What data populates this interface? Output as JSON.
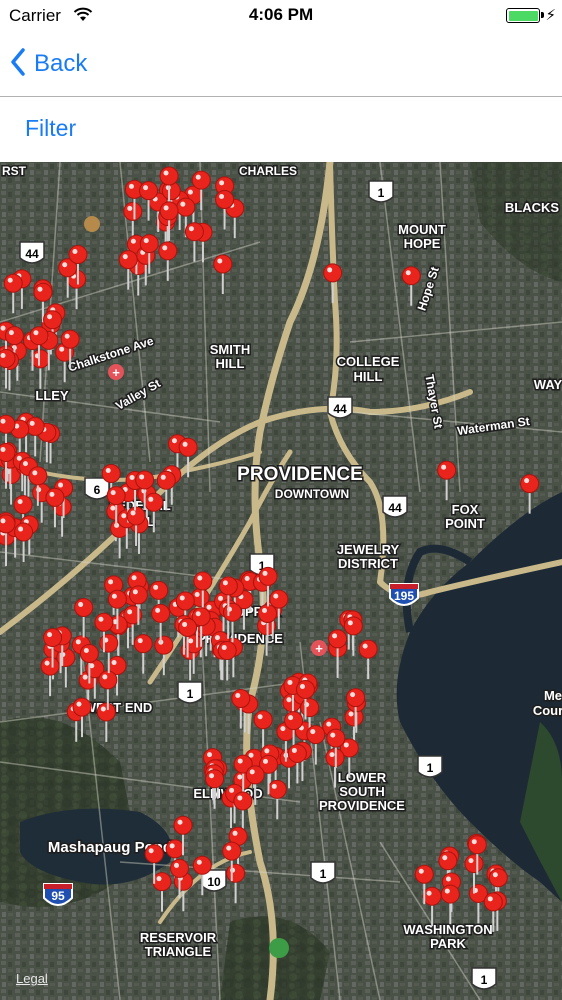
{
  "status": {
    "carrier": "Carrier",
    "time": "4:06 PM",
    "battery_level": 1.0
  },
  "nav": {
    "back_label": "Back",
    "back_icon": "chevron-left-icon"
  },
  "filter": {
    "label": "Filter"
  },
  "map": {
    "style": "satellite-hybrid",
    "pin_color": "#e8241c",
    "place_labels": [
      "CHARLES",
      "RST",
      "BLACKS",
      "MOUNT",
      "HOPE",
      "Hope St",
      "Chalkstone Ave",
      "SMITH",
      "HILL",
      "COLLEGE",
      "HILL",
      "Thayer St",
      "WAY",
      "Valley St",
      "LLEY",
      "Waterman St",
      "PROVIDENCE",
      "DOWNTOWN",
      "FOX",
      "POINT",
      "FEDERAL",
      "HILL",
      "JEWELRY",
      "DISTRICT",
      "UPPER",
      "PROVIDENCE",
      "WEST END",
      "ELMWOOD",
      "LOWER",
      "SOUTH",
      "PROVIDENCE",
      "Me",
      "Cour",
      "Mashapaug Pond",
      "RESERVOIR",
      "TRIANGLE",
      "WASHINGTON",
      "PARK"
    ],
    "route_shields": [
      "1",
      "44",
      "44",
      "6",
      "44",
      "195",
      "1",
      "1",
      "10",
      "95",
      "1",
      "1",
      "1"
    ],
    "legal_label": "Legal",
    "pin_count": 240
  }
}
